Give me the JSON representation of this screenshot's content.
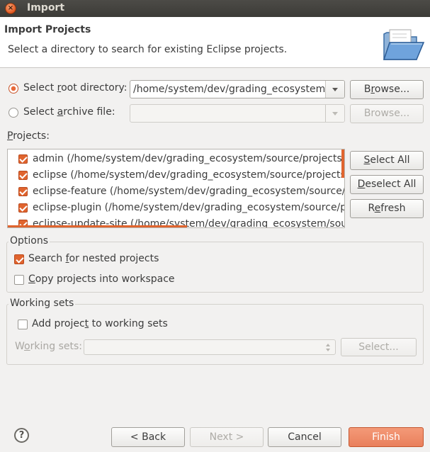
{
  "window": {
    "title": "Import",
    "close_glyph": "×"
  },
  "header": {
    "title": "Import Projects",
    "description": "Select a directory to search for existing Eclipse projects.",
    "icon": "folder-import-icon"
  },
  "source": {
    "root_radio_label_pre": "Select ",
    "root_radio_label_u": "r",
    "root_radio_label_post": "oot directory:",
    "root_value": "/home/system/dev/grading_ecosystem/",
    "archive_radio_label_pre": "Select ",
    "archive_radio_label_u": "a",
    "archive_radio_label_post": "rchive file:",
    "archive_value": "",
    "browse_label_pre": "B",
    "browse_label_u": "r",
    "browse_label_post": "owse...",
    "browse2_label": "Browse..."
  },
  "projects": {
    "label_pre": "",
    "label_u": "P",
    "label_post": "rojects:",
    "items": [
      {
        "label": "admin (/home/system/dev/grading_ecosystem/source/projects/a",
        "checked": true
      },
      {
        "label": "eclipse (/home/system/dev/grading_ecosystem/source/projects/e",
        "checked": true
      },
      {
        "label": "eclipse-feature (/home/system/dev/grading_ecosystem/source/pr",
        "checked": true
      },
      {
        "label": "eclipse-plugin (/home/system/dev/grading_ecosystem/source/pro",
        "checked": true
      },
      {
        "label": "eclipse-update-site (/home/system/dev/grading_ecosystem/sourc",
        "checked": true
      }
    ],
    "select_all_pre": "",
    "select_all_u": "S",
    "select_all_post": "elect All",
    "deselect_all_pre": "",
    "deselect_all_u": "D",
    "deselect_all_post": "eselect All",
    "refresh_pre": "R",
    "refresh_u": "e",
    "refresh_post": "fresh"
  },
  "options": {
    "title": "Options",
    "nested_pre": "Search ",
    "nested_u": "f",
    "nested_post": "or nested projects",
    "nested_checked": true,
    "copy_pre": "",
    "copy_u": "C",
    "copy_post": "opy projects into workspace",
    "copy_checked": false
  },
  "working_sets": {
    "title": "Working sets",
    "add_pre": "Add projec",
    "add_u": "t",
    "add_post": " to working sets",
    "add_checked": false,
    "sets_label_pre": "W",
    "sets_label_u": "o",
    "sets_label_post": "rking sets:",
    "select_label": "Select..."
  },
  "footer": {
    "help_glyph": "?",
    "back_label": "< Back",
    "next_label": "Next >",
    "cancel_label": "Cancel",
    "finish_label": "Finish"
  },
  "colors": {
    "accent": "#e0642e",
    "finish_bg": "#e9805c",
    "titlebar": "#3c3b37"
  }
}
